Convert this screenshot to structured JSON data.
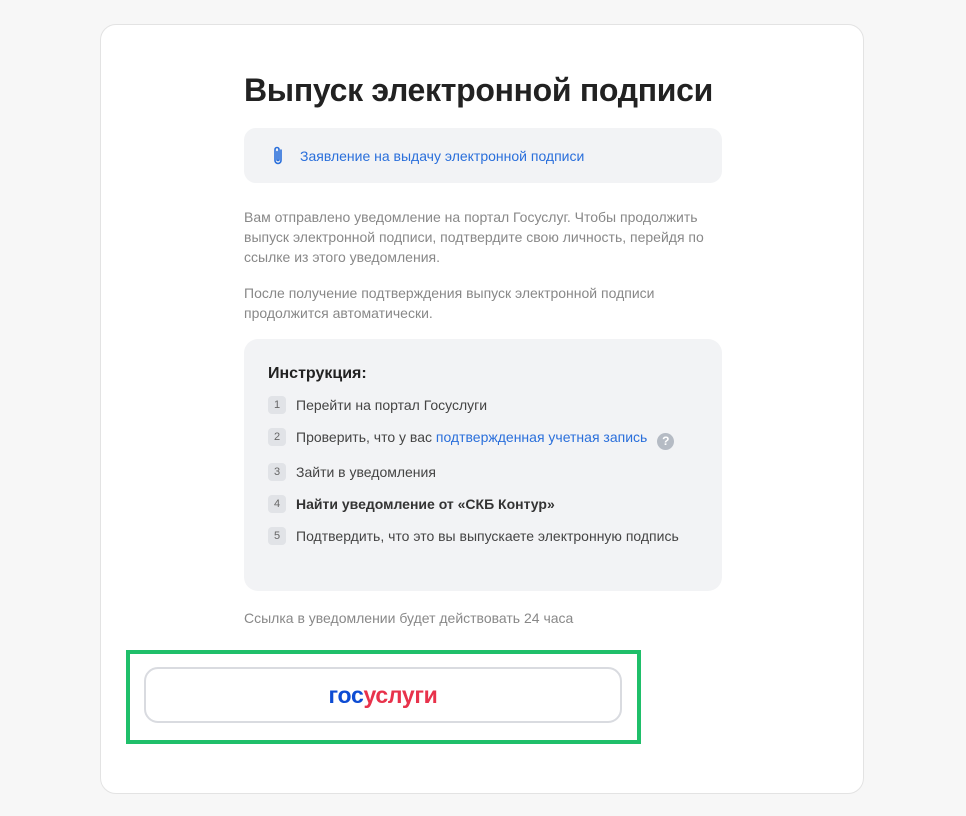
{
  "page": {
    "title": "Выпуск электронной подписи",
    "document_link": "Заявление на выдачу электронной подписи",
    "paragraphs": [
      "Вам отправлено уведомление на портал Госуслуг. Чтобы продолжить выпуск электронной подписи, подтвердите свою личность, перейдя по ссылке из этого уведомления.",
      "После получение подтверждения выпуск электронной подписи продолжится автоматически."
    ],
    "instruction": {
      "title": "Инструкция:",
      "steps": [
        {
          "num": "1",
          "text": "Перейти на портал Госуслуги"
        },
        {
          "num": "2",
          "text": "Проверить, что у вас ",
          "link": "подтвержденная учетная запись"
        },
        {
          "num": "3",
          "text": "Зайти в уведомления"
        },
        {
          "num": "4",
          "text": "Найти уведомление от «СКБ Контур»"
        },
        {
          "num": "5",
          "text": "Подтвердить, что это вы выпускаете электронную подпись"
        }
      ],
      "help_icon": "question-circle-icon"
    },
    "expiry_note": "Ссылка в уведомлении будет действовать 24 часа",
    "gosuslugi_button": {
      "logo_part1": "гос",
      "logo_part2": "услуги"
    }
  },
  "colors": {
    "link": "#2a6fdb",
    "logo_blue": "#0d4cd3",
    "logo_red": "#e8324b",
    "highlight": "#1fbf6a"
  }
}
